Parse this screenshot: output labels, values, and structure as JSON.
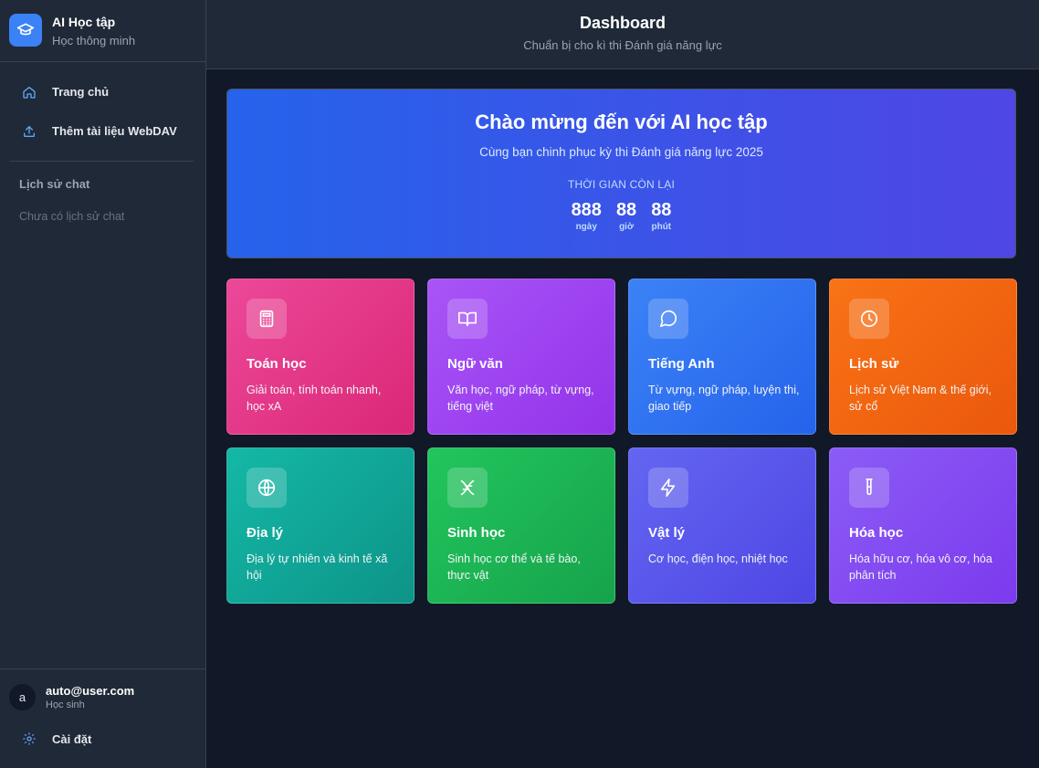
{
  "brand": {
    "title": "AI Học tập",
    "subtitle": "Học thông minh",
    "icon": "graduation-cap-icon"
  },
  "nav": [
    {
      "label": "Trang chủ",
      "icon": "home-icon"
    },
    {
      "label": "Thêm tài liệu WebDAV",
      "icon": "upload-icon"
    }
  ],
  "history": {
    "title": "Lịch sử chat",
    "empty": "Chưa có lịch sử chat"
  },
  "user": {
    "avatar": "a",
    "email": "auto@user.com",
    "role": "Học sinh"
  },
  "settings": {
    "label": "Cài đặt",
    "icon": "gear-icon"
  },
  "header": {
    "title": "Dashboard",
    "subtitle": "Chuẩn bị cho kì thi Đánh giá năng lực"
  },
  "hero": {
    "title": "Chào mừng đến với AI học tập",
    "subtitle": "Cùng bạn chinh phục kỳ thi Đánh giá năng lực 2025",
    "countdown_label": "THỜI GIAN CÒN LẠI",
    "countdown": [
      {
        "value": "888",
        "unit": "ngày"
      },
      {
        "value": "88",
        "unit": "giờ"
      },
      {
        "value": "88",
        "unit": "phút"
      }
    ]
  },
  "subjects": [
    {
      "title": "Toán học",
      "desc": "Giải toán, tính toán nhanh, học xA",
      "icon": "calculator-icon",
      "color_from": "#ec4899",
      "color_to": "#db2777"
    },
    {
      "title": "Ngữ văn",
      "desc": "Văn học, ngữ pháp, từ vựng, tiếng việt",
      "icon": "book-icon",
      "color_from": "#a855f7",
      "color_to": "#9333ea"
    },
    {
      "title": "Tiếng Anh",
      "desc": "Từ vựng, ngữ pháp, luyện thi, giao tiếp",
      "icon": "chat-bubble-icon",
      "color_from": "#3b82f6",
      "color_to": "#2563eb"
    },
    {
      "title": "Lịch sử",
      "desc": "Lịch sử Việt Nam & thế giới, sử cổ",
      "icon": "clock-icon",
      "color_from": "#f97316",
      "color_to": "#ea580c"
    },
    {
      "title": "Địa lý",
      "desc": "Địa lý tự nhiên và kinh tế xã hội",
      "icon": "globe-icon",
      "color_from": "#14b8a6",
      "color_to": "#0d9488"
    },
    {
      "title": "Sinh học",
      "desc": "Sinh học cơ thể và tế bào, thực vật",
      "icon": "dna-icon",
      "color_from": "#22c55e",
      "color_to": "#16a34a"
    },
    {
      "title": "Vật lý",
      "desc": "Cơ học, điện học, nhiệt học",
      "icon": "lightning-icon",
      "color_from": "#6366f1",
      "color_to": "#4f46e5"
    },
    {
      "title": "Hóa học",
      "desc": "Hóa hữu cơ, hóa vô cơ, hóa phân tích",
      "icon": "test-tube-icon",
      "color_from": "#8b5cf6",
      "color_to": "#7c3aed"
    }
  ]
}
